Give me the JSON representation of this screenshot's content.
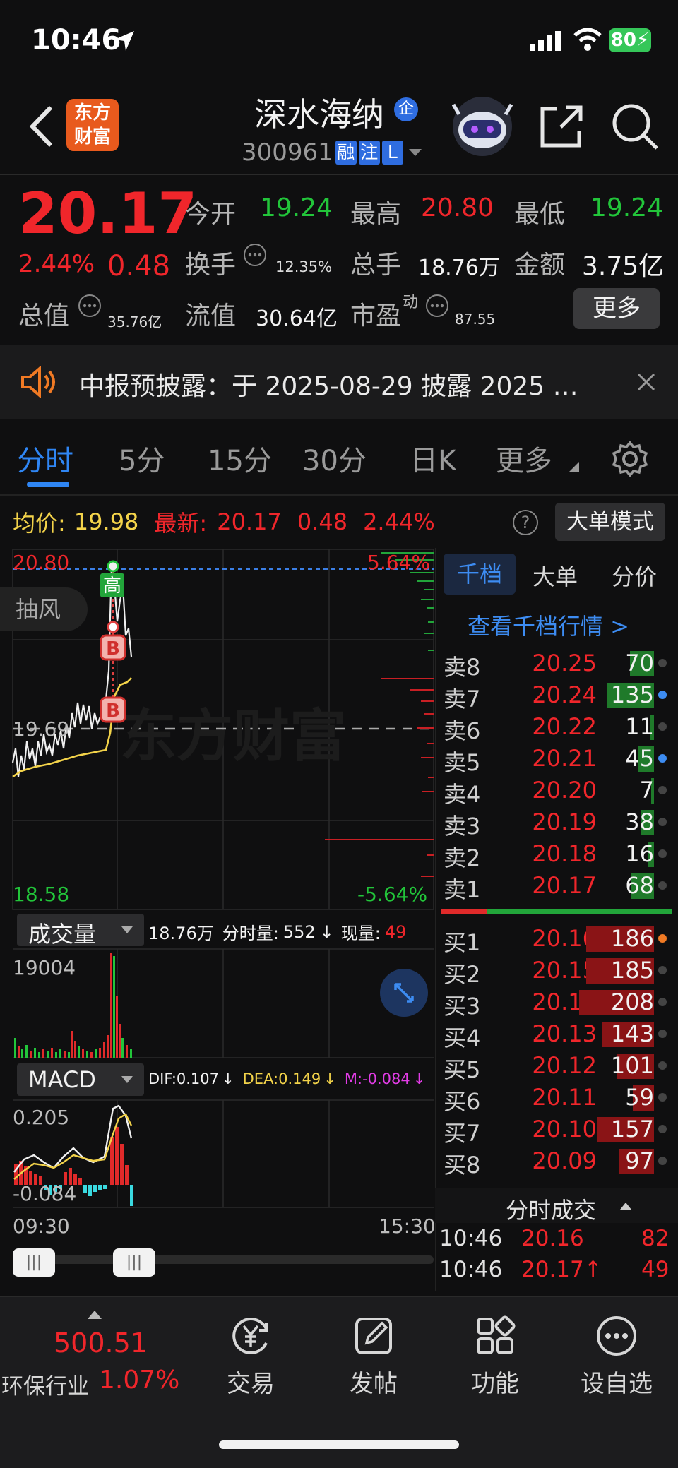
{
  "status_bar": {
    "time": "10:46",
    "battery": "80"
  },
  "header": {
    "logo_text_top": "东方",
    "logo_text_bottom": "财富",
    "stock_name": "深水海纳",
    "name_badge": "企",
    "stock_code": "300961",
    "badges": [
      "融",
      "注",
      "L"
    ]
  },
  "quote": {
    "price": "20.17",
    "change_pct": "2.44%",
    "change": "0.48",
    "open_label": "今开",
    "open": "19.24",
    "high_label": "最高",
    "high": "20.80",
    "low_label": "最低",
    "low": "19.24",
    "turnover_label": "换手",
    "turnover": "12.35%",
    "volume_label": "总手",
    "volume": "18.76万",
    "amount_label": "金额",
    "amount": "3.75亿",
    "mktcap_label": "总值",
    "mktcap": "35.76亿",
    "float_label": "流值",
    "float_cap": "30.64亿",
    "pe_label": "市盈",
    "pe_sup": "动",
    "pe": "87.55",
    "more_button": "更多"
  },
  "notice": {
    "text": "中报预披露：于 2025-08-29 披露 2025 …"
  },
  "tabs": [
    "分时",
    "5分",
    "15分",
    "30分",
    "日K",
    "更多"
  ],
  "chart_info": {
    "avg_label": "均价:",
    "avg": "19.98",
    "last_label": "最新:",
    "last": "20.17",
    "chg": "0.48",
    "pct": "2.44%",
    "mode_button": "大单模式",
    "help": "?"
  },
  "intraday": {
    "top_price": "20.80",
    "top_pct": "5.64%",
    "mid_price": "19.69",
    "bottom_price": "18.58",
    "bottom_pct": "-5.64%",
    "watermark": "东方财富",
    "marker_high": "高",
    "marker_buy": "B",
    "side_pill": "抽风"
  },
  "volume_panel": {
    "selector": "成交量",
    "total": "18.76万",
    "minute_label": "分时量:",
    "minute": "552",
    "current_label": "现量:",
    "current": "49",
    "max": "19004"
  },
  "macd_panel": {
    "selector": "MACD",
    "dif": "DIF:0.107",
    "dea": "DEA:0.149",
    "m": "M:-0.084",
    "top": "0.205",
    "bottom": "-0.084"
  },
  "time_axis": {
    "start": "09:30",
    "end": "15:30"
  },
  "orderbook": {
    "tabs": [
      "千档",
      "大单",
      "分价"
    ],
    "link": "查看千档行情 >",
    "asks": [
      {
        "label": "卖8",
        "price": "20.25",
        "vol": "70"
      },
      {
        "label": "卖7",
        "price": "20.24",
        "vol": "135"
      },
      {
        "label": "卖6",
        "price": "20.22",
        "vol": "11"
      },
      {
        "label": "卖5",
        "price": "20.21",
        "vol": "45"
      },
      {
        "label": "卖4",
        "price": "20.20",
        "vol": "7"
      },
      {
        "label": "卖3",
        "price": "20.19",
        "vol": "38"
      },
      {
        "label": "卖2",
        "price": "20.18",
        "vol": "16"
      },
      {
        "label": "卖1",
        "price": "20.17",
        "vol": "68"
      }
    ],
    "bids": [
      {
        "label": "买1",
        "price": "20.16",
        "vol": "186"
      },
      {
        "label": "买2",
        "price": "20.15",
        "vol": "185"
      },
      {
        "label": "买3",
        "price": "20.14",
        "vol": "208"
      },
      {
        "label": "买4",
        "price": "20.13",
        "vol": "143"
      },
      {
        "label": "买5",
        "price": "20.12",
        "vol": "101"
      },
      {
        "label": "买6",
        "price": "20.11",
        "vol": "59"
      },
      {
        "label": "买7",
        "price": "20.10",
        "vol": "157"
      },
      {
        "label": "买8",
        "price": "20.09",
        "vol": "97"
      }
    ],
    "ticks_header": "分时成交",
    "ticks": [
      {
        "time": "10:46",
        "price": "20.16",
        "vol": "82"
      },
      {
        "time": "10:46",
        "price": "20.17↑",
        "vol": "49"
      }
    ]
  },
  "bottom_bar": {
    "index_value": "500.51",
    "index_name": "环保行业",
    "index_pct": "1.07%",
    "items": [
      "交易",
      "发帖",
      "功能",
      "设自选"
    ]
  }
}
